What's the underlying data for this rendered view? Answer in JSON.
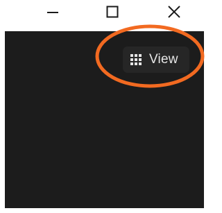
{
  "window": {
    "controls": {
      "minimize": "minimize-icon",
      "maximize": "maximize-icon",
      "close": "close-icon"
    }
  },
  "content": {
    "background": "#1c1c1c",
    "view_button": {
      "label": "View",
      "icon": "grid-icon"
    }
  },
  "annotation": {
    "highlight_color": "#f26a21",
    "shape": "ellipse"
  }
}
